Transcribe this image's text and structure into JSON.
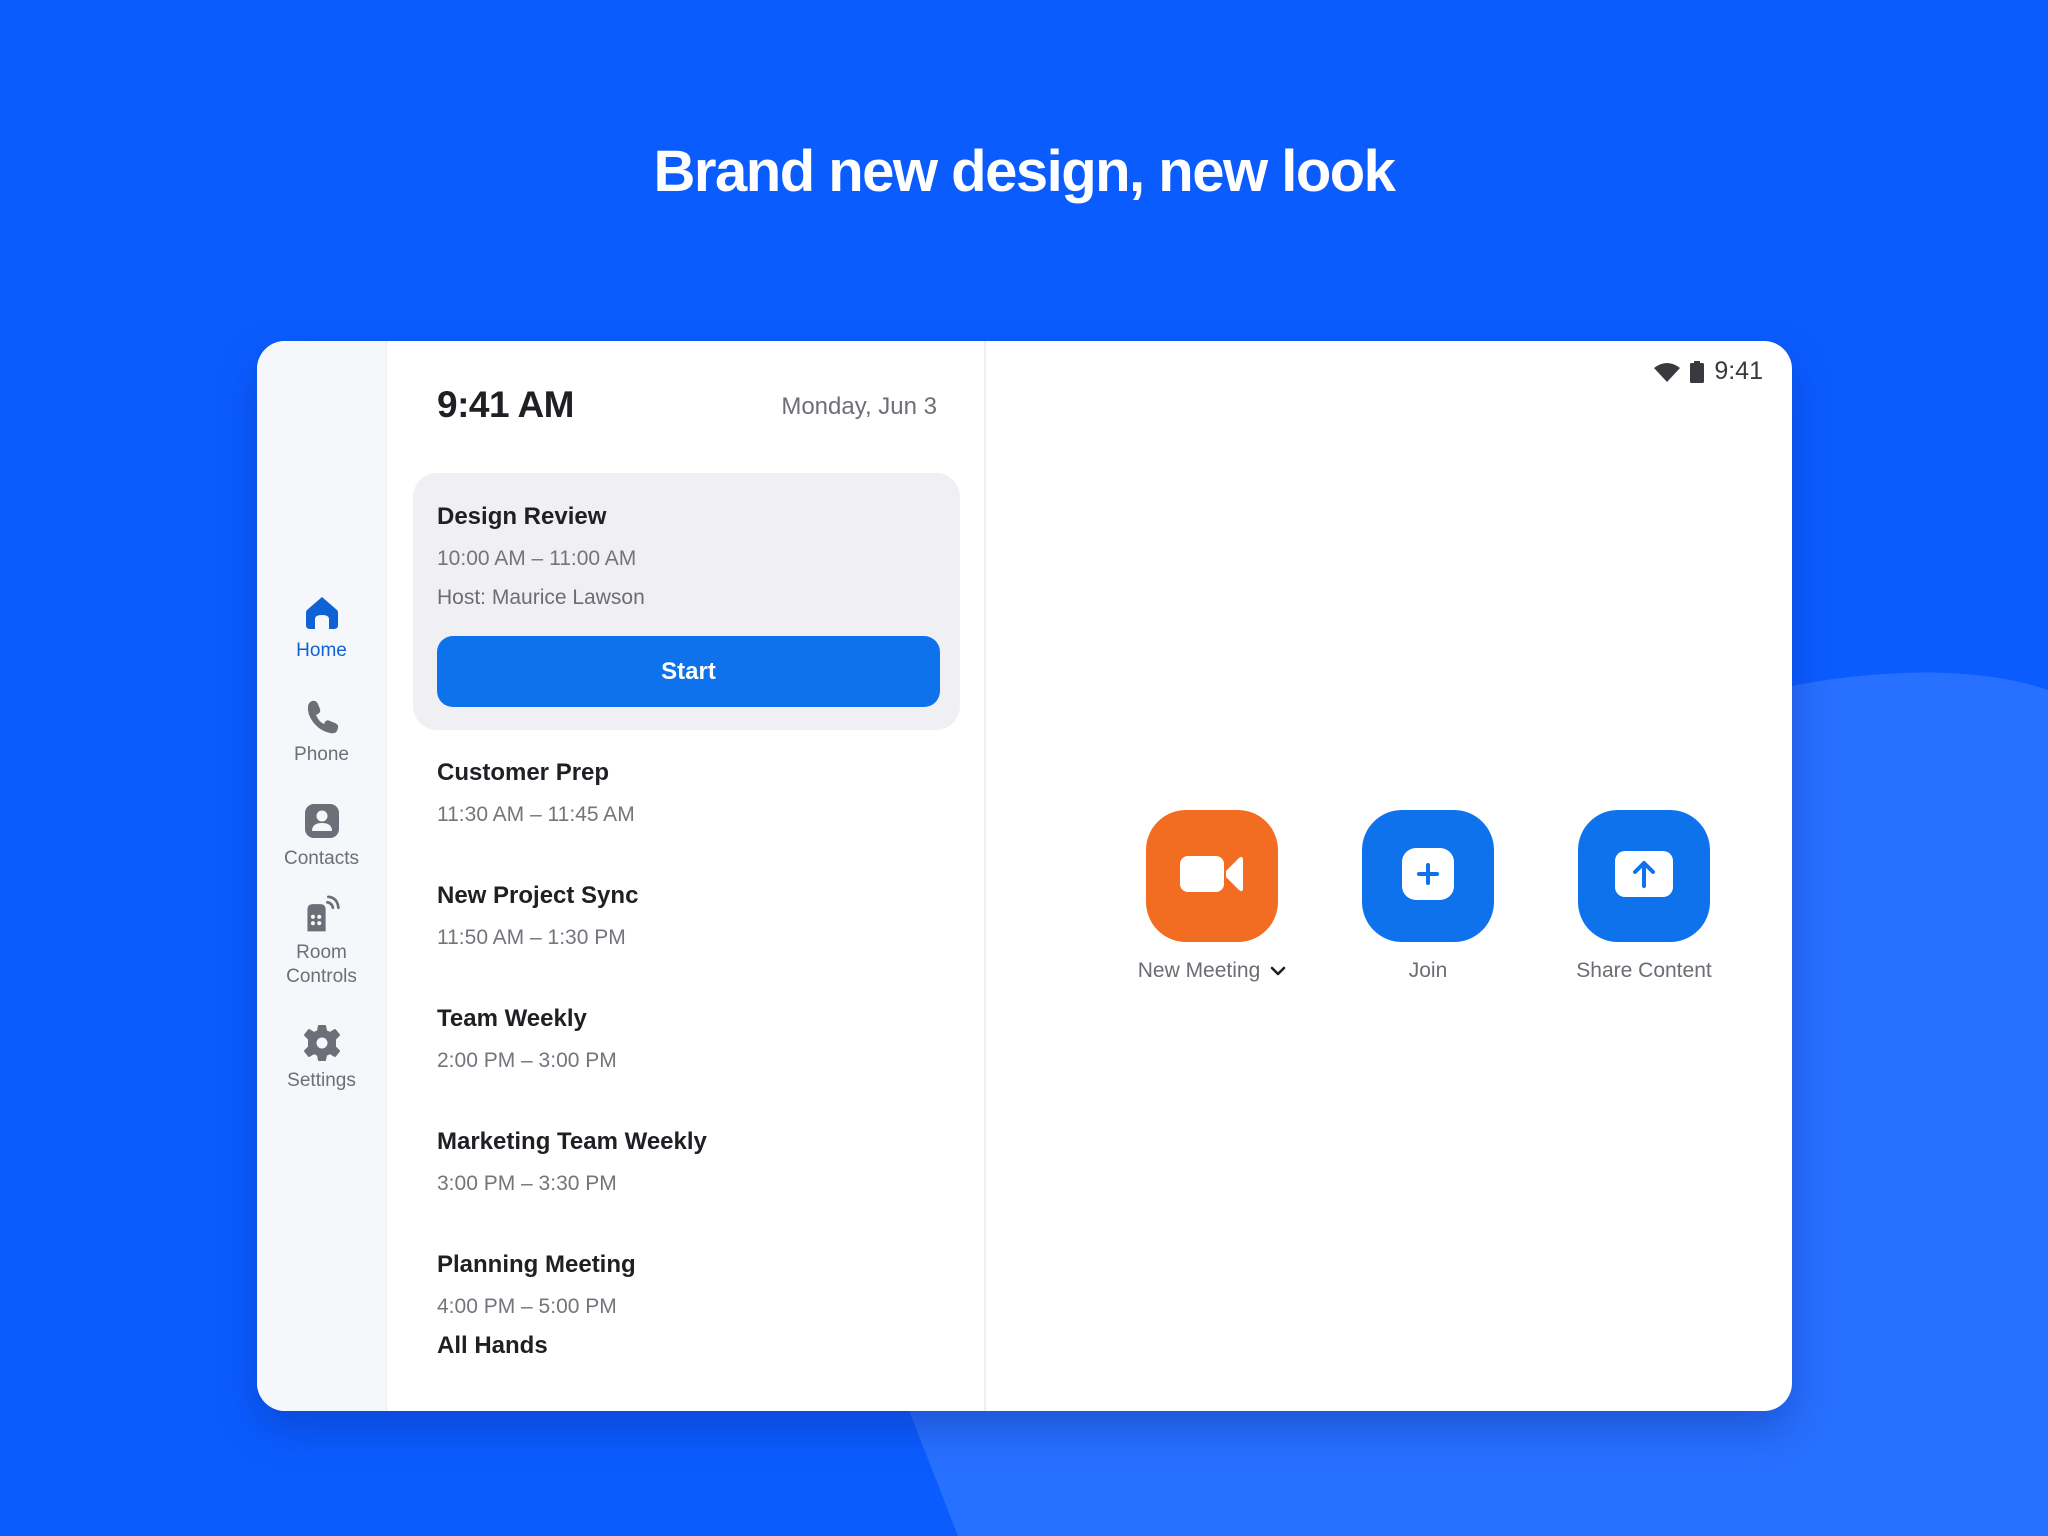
{
  "headline": "Brand new design, new look",
  "colors": {
    "background": "#0b5cff",
    "background_shape": "#2870ff",
    "accent_blue": "#0e72ed",
    "accent_orange": "#f26d21",
    "active_nav": "#0e62d6",
    "nav_inactive": "#6e6e78"
  },
  "sidebar": {
    "items": [
      {
        "label": "Home",
        "icon": "home-icon",
        "active": true
      },
      {
        "label": "Phone",
        "icon": "phone-icon",
        "active": false
      },
      {
        "label": "Contacts",
        "icon": "contacts-icon",
        "active": false
      },
      {
        "label": "Room Controls",
        "icon": "room-controls-icon",
        "active": false
      },
      {
        "label": "Settings",
        "icon": "gear-icon",
        "active": false
      }
    ]
  },
  "schedule": {
    "time": "9:41 AM",
    "date": "Monday, Jun 3",
    "featured": {
      "title": "Design Review",
      "time": "10:00 AM – 11:00 AM",
      "host": "Host: Maurice Lawson",
      "button_label": "Start"
    },
    "meetings": [
      {
        "title": "Customer Prep",
        "time": "11:30 AM – 11:45 AM"
      },
      {
        "title": "New Project Sync",
        "time": "11:50 AM – 1:30 PM"
      },
      {
        "title": "Team Weekly",
        "time": "2:00 PM – 3:00 PM"
      },
      {
        "title": "Marketing Team Weekly",
        "time": "3:00 PM – 3:30 PM"
      },
      {
        "title": "Planning Meeting",
        "time": "4:00 PM – 5:00 PM"
      },
      {
        "title": "All Hands",
        "time": ""
      }
    ]
  },
  "status_bar": {
    "time": "9:41",
    "icons": [
      "wifi-icon",
      "battery-icon"
    ]
  },
  "actions": [
    {
      "label": "New Meeting",
      "icon": "video-camera-icon",
      "has_dropdown": true
    },
    {
      "label": "Join",
      "icon": "plus-icon",
      "has_dropdown": false
    },
    {
      "label": "Share Content",
      "icon": "upload-arrow-icon",
      "has_dropdown": false
    }
  ]
}
